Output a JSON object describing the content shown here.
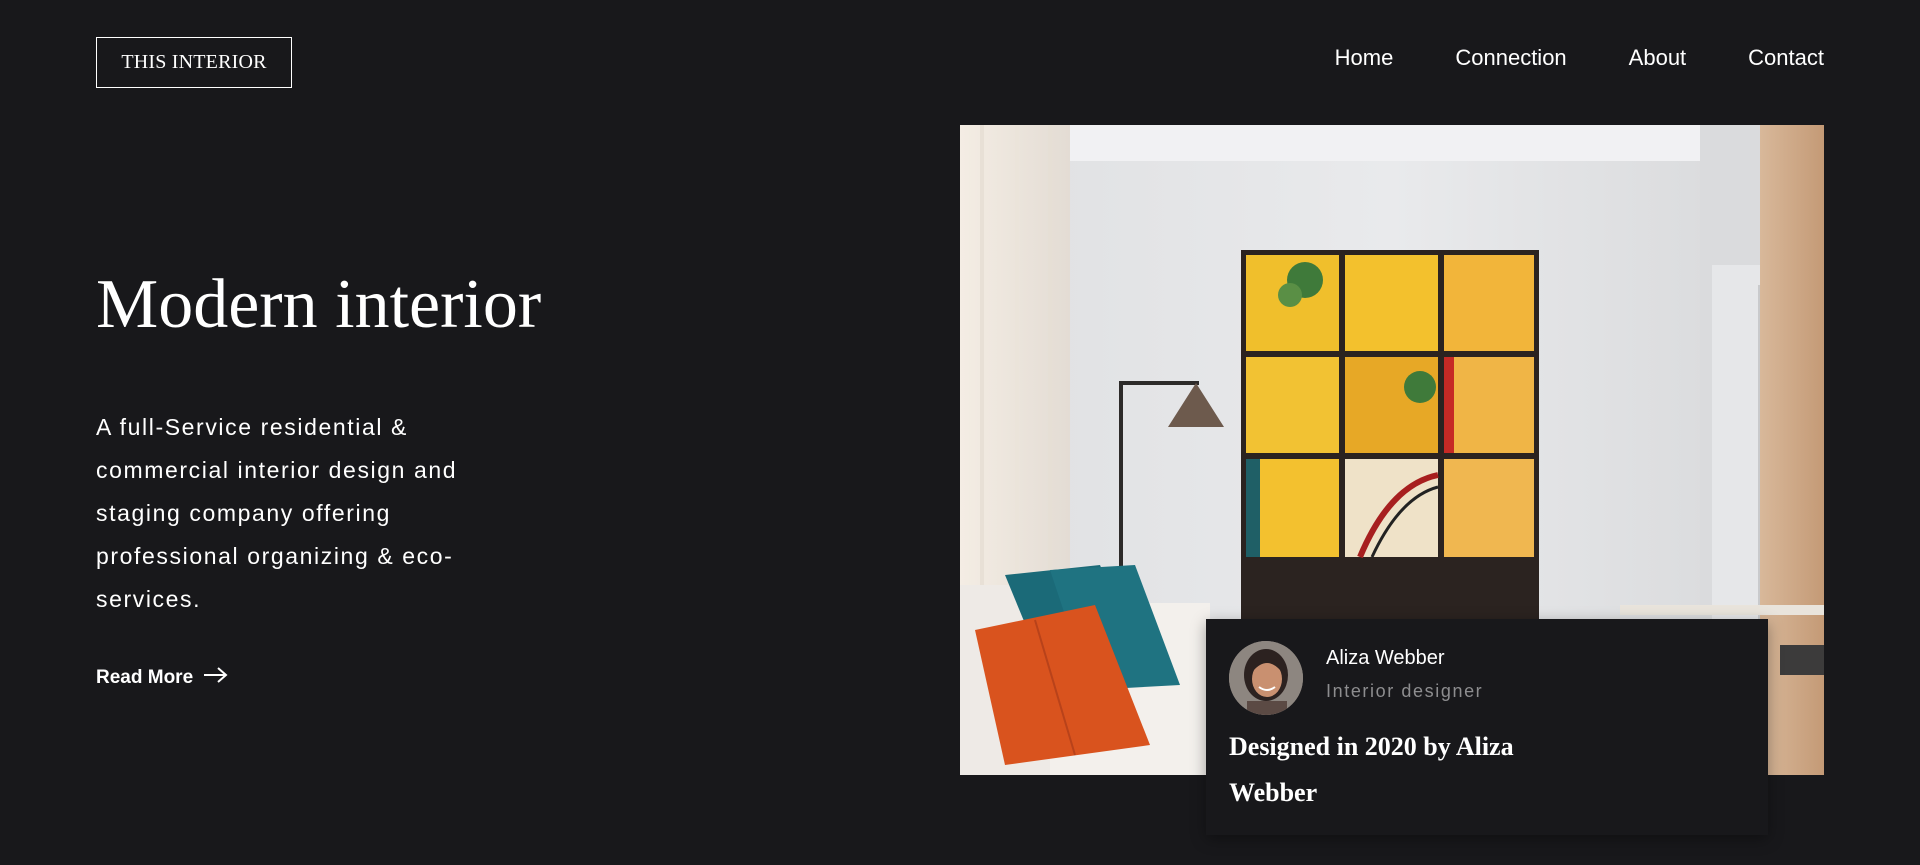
{
  "brand": {
    "logo": "THIS INTERIOR"
  },
  "nav": {
    "items": [
      {
        "label": "Home"
      },
      {
        "label": "Connection"
      },
      {
        "label": "About"
      },
      {
        "label": "Contact"
      }
    ]
  },
  "hero": {
    "title": "Modern interior",
    "description": "A full-Service residential & commercial interior design and staging company offering professional organizing & eco-services.",
    "cta_label": "Read More",
    "cta_icon": "arrow-right-icon"
  },
  "card": {
    "author_name": "Aliza Webber",
    "author_role": "Interior designer",
    "caption": "Designed in 2020 by Aliza Webber"
  },
  "colors": {
    "background": "#18181b",
    "text": "#ffffff",
    "muted": "#8d8d8f",
    "accent_yellow": "#f2c12e",
    "accent_orange": "#d9531e",
    "accent_teal": "#1f6f7a"
  }
}
